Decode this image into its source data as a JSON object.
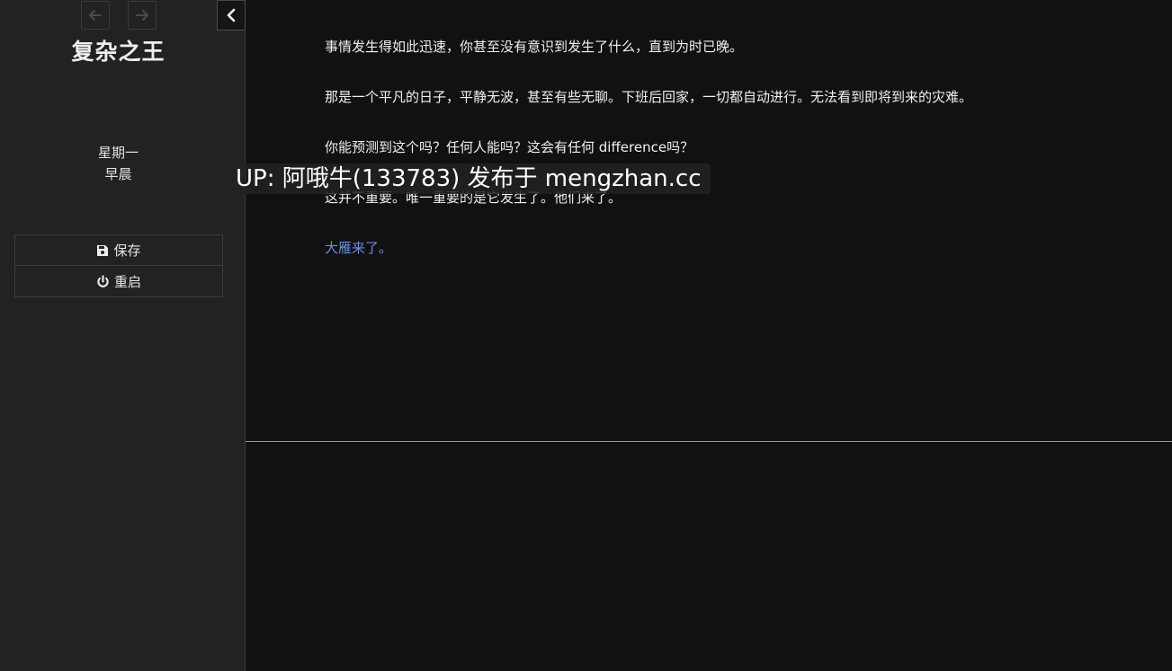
{
  "sidebar": {
    "back_icon": "arrow-left-icon",
    "forward_icon": "arrow-right-icon",
    "collapse_icon": "chevron-left-icon",
    "title": "复杂之王",
    "day": "星期一",
    "time_of_day": "早晨",
    "menu": [
      {
        "label": "保存",
        "icon": "floppy-disk-icon"
      },
      {
        "label": "重启",
        "icon": "power-icon"
      }
    ]
  },
  "passage": {
    "paragraphs": [
      "事情发生得如此迅速，你甚至没有意识到发生了什么，直到为时已晚。",
      "那是一个平凡的日子，平静无波，甚至有些无聊。下班后回家，一切都自动进行。无法看到即将到来的灾难。",
      "你能预测到这个吗？任何人能吗？这会有任何 difference吗？",
      "这并不重要。唯一重要的是它发生了。他们来了。"
    ],
    "link": "大雁来了。"
  },
  "watermark": "UP: 阿哦牛(133783) 发布于 mengzhan.cc",
  "colors": {
    "sidebar_bg": "#222222",
    "main_bg": "#111111",
    "link": "#6f8de0"
  }
}
